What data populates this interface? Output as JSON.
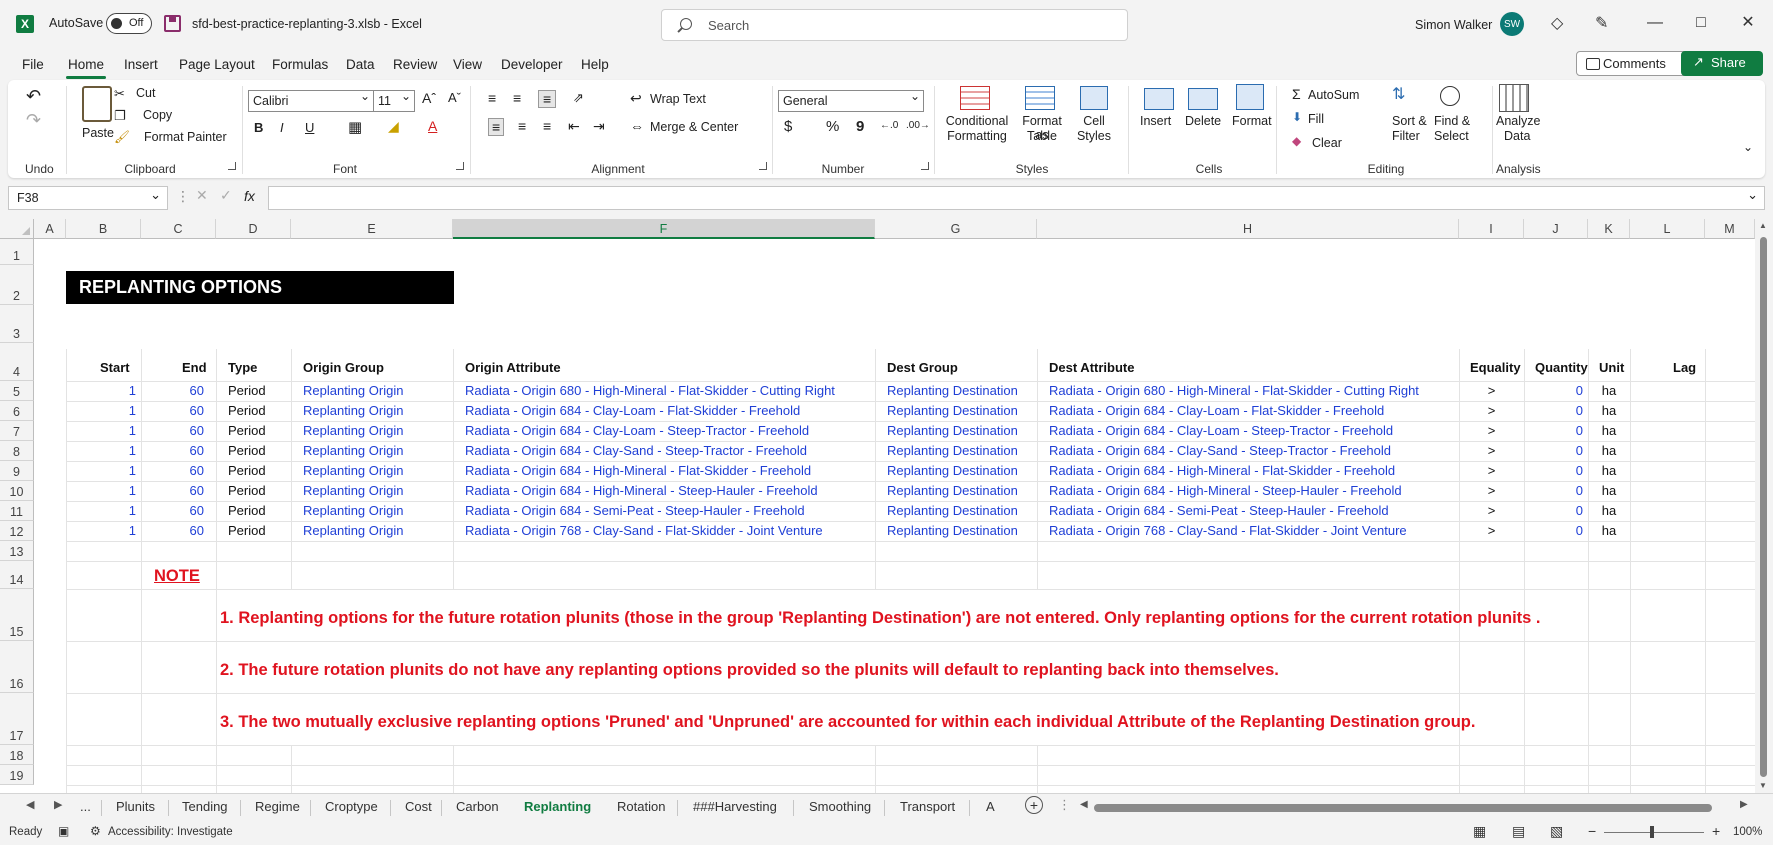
{
  "titlebar": {
    "autosave_label": "AutoSave",
    "autosave_state": "Off",
    "doc_title": "sfd-best-practice-replanting-3.xlsb  -  Excel",
    "search_placeholder": "Search",
    "user_name": "Simon Walker",
    "user_initials": "SW"
  },
  "menu": {
    "items": [
      "File",
      "Home",
      "Insert",
      "Page Layout",
      "Formulas",
      "Data",
      "Review",
      "View",
      "Developer",
      "Help"
    ],
    "active": "Home",
    "comments_label": "Comments",
    "share_label": "Share"
  },
  "ribbon": {
    "groups": {
      "undo": "Undo",
      "clipboard": "Clipboard",
      "font": "Font",
      "alignment": "Alignment",
      "number": "Number",
      "styles": "Styles",
      "cells": "Cells",
      "editing": "Editing",
      "analysis": "Analysis"
    },
    "clipboard": {
      "paste": "Paste",
      "cut": "Cut",
      "copy": "Copy",
      "format_painter": "Format Painter"
    },
    "font": {
      "name": "Calibri",
      "size": "11",
      "bold": "B",
      "italic": "I",
      "underline": "U"
    },
    "alignment": {
      "wrap_text": "Wrap Text",
      "merge_center": "Merge & Center"
    },
    "number": {
      "format": "General",
      "currency": "$",
      "percent": "%",
      "comma": "9"
    },
    "styles": {
      "conditional": [
        "Conditional",
        "Formatting"
      ],
      "format_table": [
        "Format as",
        "Table"
      ],
      "cell_styles": [
        "Cell",
        "Styles"
      ]
    },
    "cells": {
      "insert": "Insert",
      "delete": "Delete",
      "format": "Format"
    },
    "editing": {
      "autosum": "AutoSum",
      "fill": "Fill",
      "clear": "Clear",
      "sort": [
        "Sort &",
        "Filter"
      ],
      "find": [
        "Find &",
        "Select"
      ]
    },
    "analysis": {
      "analyze": [
        "Analyze",
        "Data"
      ]
    }
  },
  "formula_bar": {
    "name_box": "F38",
    "fx": "fx",
    "formula": ""
  },
  "columns": [
    "A",
    "B",
    "C",
    "D",
    "E",
    "F",
    "G",
    "H",
    "I",
    "J",
    "K",
    "L",
    "M"
  ],
  "selected_column": "F",
  "rows": [
    "1",
    "2",
    "3",
    "4",
    "5",
    "6",
    "7",
    "8",
    "9",
    "10",
    "11",
    "12",
    "13",
    "14",
    "15",
    "16",
    "17",
    "18",
    "19"
  ],
  "sheet": {
    "title": "REPLANTING OPTIONS",
    "headers": {
      "start": "Start",
      "end": "End",
      "type": "Type",
      "origin_group": "Origin Group",
      "origin_attribute": "Origin Attribute",
      "dest_group": "Dest Group",
      "dest_attribute": "Dest Attribute",
      "equality": "Equality",
      "quantity": "Quantity",
      "unit": "Unit",
      "lag": "Lag"
    },
    "data_rows": [
      {
        "start": "1",
        "end": "60",
        "type": "Period",
        "origin_group": "Replanting Origin",
        "origin_attribute": "Radiata - Origin 680 - High-Mineral - Flat-Skidder - Cutting Right",
        "dest_group": "Replanting Destination",
        "dest_attribute": "Radiata - Origin 680 - High-Mineral - Flat-Skidder - Cutting Right",
        "equality": ">",
        "quantity": "0",
        "unit": "ha"
      },
      {
        "start": "1",
        "end": "60",
        "type": "Period",
        "origin_group": "Replanting Origin",
        "origin_attribute": "Radiata - Origin 684 - Clay-Loam - Flat-Skidder - Freehold",
        "dest_group": "Replanting Destination",
        "dest_attribute": "Radiata - Origin 684 - Clay-Loam - Flat-Skidder - Freehold",
        "equality": ">",
        "quantity": "0",
        "unit": "ha"
      },
      {
        "start": "1",
        "end": "60",
        "type": "Period",
        "origin_group": "Replanting Origin",
        "origin_attribute": "Radiata - Origin 684 - Clay-Loam - Steep-Tractor - Freehold",
        "dest_group": "Replanting Destination",
        "dest_attribute": "Radiata - Origin 684 - Clay-Loam - Steep-Tractor - Freehold",
        "equality": ">",
        "quantity": "0",
        "unit": "ha"
      },
      {
        "start": "1",
        "end": "60",
        "type": "Period",
        "origin_group": "Replanting Origin",
        "origin_attribute": "Radiata - Origin 684 - Clay-Sand - Steep-Tractor - Freehold",
        "dest_group": "Replanting Destination",
        "dest_attribute": "Radiata - Origin 684 - Clay-Sand - Steep-Tractor - Freehold",
        "equality": ">",
        "quantity": "0",
        "unit": "ha"
      },
      {
        "start": "1",
        "end": "60",
        "type": "Period",
        "origin_group": "Replanting Origin",
        "origin_attribute": "Radiata - Origin 684 - High-Mineral - Flat-Skidder - Freehold",
        "dest_group": "Replanting Destination",
        "dest_attribute": "Radiata - Origin 684 - High-Mineral - Flat-Skidder - Freehold",
        "equality": ">",
        "quantity": "0",
        "unit": "ha"
      },
      {
        "start": "1",
        "end": "60",
        "type": "Period",
        "origin_group": "Replanting Origin",
        "origin_attribute": "Radiata - Origin 684 - High-Mineral - Steep-Hauler - Freehold",
        "dest_group": "Replanting Destination",
        "dest_attribute": "Radiata - Origin 684 - High-Mineral - Steep-Hauler - Freehold",
        "equality": ">",
        "quantity": "0",
        "unit": "ha"
      },
      {
        "start": "1",
        "end": "60",
        "type": "Period",
        "origin_group": "Replanting Origin",
        "origin_attribute": "Radiata - Origin 684 - Semi-Peat - Steep-Hauler - Freehold",
        "dest_group": "Replanting Destination",
        "dest_attribute": "Radiata - Origin 684 - Semi-Peat - Steep-Hauler - Freehold",
        "equality": ">",
        "quantity": "0",
        "unit": "ha"
      },
      {
        "start": "1",
        "end": "60",
        "type": "Period",
        "origin_group": "Replanting Origin",
        "origin_attribute": "Radiata - Origin 768 - Clay-Sand - Flat-Skidder - Joint Venture",
        "dest_group": "Replanting Destination",
        "dest_attribute": "Radiata - Origin 768 - Clay-Sand - Flat-Skidder - Joint Venture",
        "equality": ">",
        "quantity": "0",
        "unit": "ha"
      }
    ],
    "note_title": "NOTE",
    "notes": [
      "1. Replanting options for the future rotation plunits (those in the group 'Replanting Destination') are not entered.  Only replanting options for the current rotation plunits .",
      "2.  The future rotation plunits do not have any replanting options provided so the plunits will default to replanting back into themselves.",
      "3. The two mutually exclusive replanting options 'Pruned' and 'Unpruned' are accounted for within each individual Attribute of the Replanting Destination group."
    ]
  },
  "sheet_tabs": {
    "ellipsis": "...",
    "tabs": [
      "Plunits",
      "Tending",
      "Regime",
      "Croptype",
      "Cost",
      "Carbon",
      "Replanting",
      "Rotation",
      "###Harvesting",
      "Smoothing",
      "Transport",
      "A"
    ],
    "active": "Replanting"
  },
  "status": {
    "ready": "Ready",
    "accessibility": "Accessibility: Investigate",
    "zoom": "100%"
  },
  "colors": {
    "excel_green": "#107c41",
    "data_blue": "#1f3fd6",
    "note_red": "#e0131f"
  }
}
